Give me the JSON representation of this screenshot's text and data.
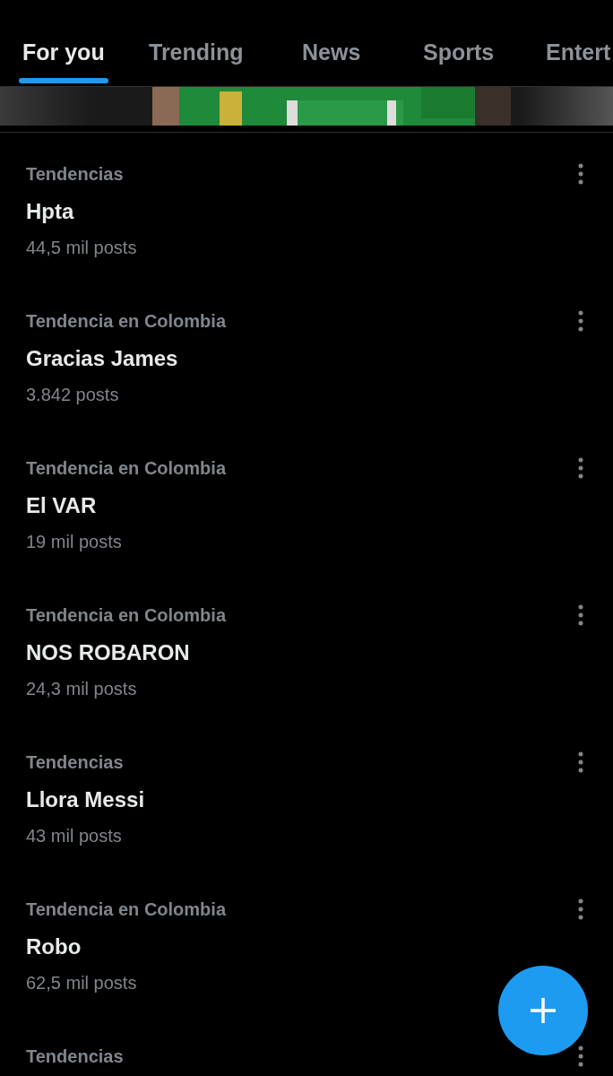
{
  "tabs": [
    {
      "label": "For you",
      "selected": true
    },
    {
      "label": "Trending",
      "selected": false
    },
    {
      "label": "News",
      "selected": false
    },
    {
      "label": "Sports",
      "selected": false
    },
    {
      "label": "Entert",
      "selected": false
    }
  ],
  "trends": [
    {
      "category": "Tendencias",
      "title": "Hpta",
      "count": "44,5 mil posts"
    },
    {
      "category": "Tendencia en Colombia",
      "title": "Gracias James",
      "count": "3.842 posts"
    },
    {
      "category": "Tendencia en Colombia",
      "title": "El VAR",
      "count": "19 mil posts"
    },
    {
      "category": "Tendencia en Colombia",
      "title": "NOS ROBARON",
      "count": "24,3 mil posts"
    },
    {
      "category": "Tendencias",
      "title": "Llora Messi",
      "count": "43 mil posts"
    },
    {
      "category": "Tendencia en Colombia",
      "title": "Robo",
      "count": "62,5 mil posts"
    },
    {
      "category": "Tendencias"
    }
  ]
}
